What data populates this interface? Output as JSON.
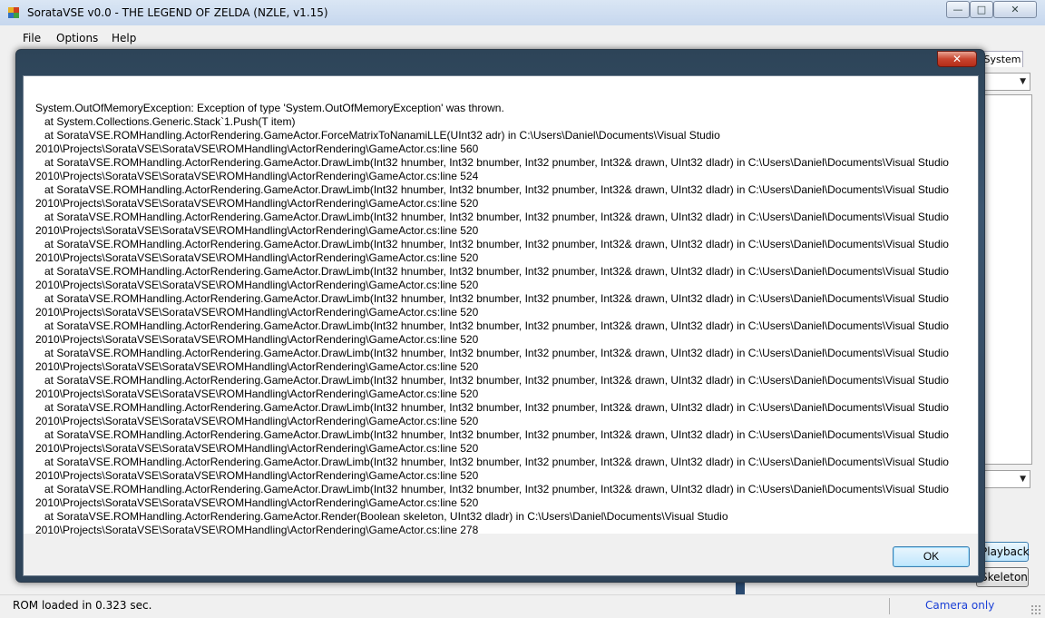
{
  "window": {
    "title": "SorataVSE v0.0 - THE LEGEND OF ZELDA (NZLE, v1.15)",
    "minimize_glyph": "—",
    "maximize_glyph": "□",
    "close_glyph": "✕"
  },
  "menu": {
    "items": [
      "File",
      "Options",
      "Help"
    ]
  },
  "background": {
    "tab_partial": "System",
    "button_playback_partial": "Playback",
    "button_skeleton_partial": "Skeleton"
  },
  "status": {
    "left": "ROM loaded in 0.323 sec.",
    "right": "Camera only"
  },
  "dialog": {
    "close_glyph": "✕",
    "ok_label": "OK",
    "message": "System.OutOfMemoryException: Exception of type 'System.OutOfMemoryException' was thrown.\n   at System.Collections.Generic.Stack`1.Push(T item)\n   at SorataVSE.ROMHandling.ActorRendering.GameActor.ForceMatrixToNanamiLLE(UInt32 adr) in C:\\Users\\Daniel\\Documents\\Visual Studio\n2010\\Projects\\SorataVSE\\SorataVSE\\ROMHandling\\ActorRendering\\GameActor.cs:line 560\n   at SorataVSE.ROMHandling.ActorRendering.GameActor.DrawLimb(Int32 hnumber, Int32 bnumber, Int32 pnumber, Int32& drawn, UInt32 dladr) in C:\\Users\\Daniel\\Documents\\Visual Studio\n2010\\Projects\\SorataVSE\\SorataVSE\\ROMHandling\\ActorRendering\\GameActor.cs:line 524\n   at SorataVSE.ROMHandling.ActorRendering.GameActor.DrawLimb(Int32 hnumber, Int32 bnumber, Int32 pnumber, Int32& drawn, UInt32 dladr) in C:\\Users\\Daniel\\Documents\\Visual Studio\n2010\\Projects\\SorataVSE\\SorataVSE\\ROMHandling\\ActorRendering\\GameActor.cs:line 520\n   at SorataVSE.ROMHandling.ActorRendering.GameActor.DrawLimb(Int32 hnumber, Int32 bnumber, Int32 pnumber, Int32& drawn, UInt32 dladr) in C:\\Users\\Daniel\\Documents\\Visual Studio\n2010\\Projects\\SorataVSE\\SorataVSE\\ROMHandling\\ActorRendering\\GameActor.cs:line 520\n   at SorataVSE.ROMHandling.ActorRendering.GameActor.DrawLimb(Int32 hnumber, Int32 bnumber, Int32 pnumber, Int32& drawn, UInt32 dladr) in C:\\Users\\Daniel\\Documents\\Visual Studio\n2010\\Projects\\SorataVSE\\SorataVSE\\ROMHandling\\ActorRendering\\GameActor.cs:line 520\n   at SorataVSE.ROMHandling.ActorRendering.GameActor.DrawLimb(Int32 hnumber, Int32 bnumber, Int32 pnumber, Int32& drawn, UInt32 dladr) in C:\\Users\\Daniel\\Documents\\Visual Studio\n2010\\Projects\\SorataVSE\\SorataVSE\\ROMHandling\\ActorRendering\\GameActor.cs:line 520\n   at SorataVSE.ROMHandling.ActorRendering.GameActor.DrawLimb(Int32 hnumber, Int32 bnumber, Int32 pnumber, Int32& drawn, UInt32 dladr) in C:\\Users\\Daniel\\Documents\\Visual Studio\n2010\\Projects\\SorataVSE\\SorataVSE\\ROMHandling\\ActorRendering\\GameActor.cs:line 520\n   at SorataVSE.ROMHandling.ActorRendering.GameActor.DrawLimb(Int32 hnumber, Int32 bnumber, Int32 pnumber, Int32& drawn, UInt32 dladr) in C:\\Users\\Daniel\\Documents\\Visual Studio\n2010\\Projects\\SorataVSE\\SorataVSE\\ROMHandling\\ActorRendering\\GameActor.cs:line 520\n   at SorataVSE.ROMHandling.ActorRendering.GameActor.DrawLimb(Int32 hnumber, Int32 bnumber, Int32 pnumber, Int32& drawn, UInt32 dladr) in C:\\Users\\Daniel\\Documents\\Visual Studio\n2010\\Projects\\SorataVSE\\SorataVSE\\ROMHandling\\ActorRendering\\GameActor.cs:line 520\n   at SorataVSE.ROMHandling.ActorRendering.GameActor.DrawLimb(Int32 hnumber, Int32 bnumber, Int32 pnumber, Int32& drawn, UInt32 dladr) in C:\\Users\\Daniel\\Documents\\Visual Studio\n2010\\Projects\\SorataVSE\\SorataVSE\\ROMHandling\\ActorRendering\\GameActor.cs:line 520\n   at SorataVSE.ROMHandling.ActorRendering.GameActor.DrawLimb(Int32 hnumber, Int32 bnumber, Int32 pnumber, Int32& drawn, UInt32 dladr) in C:\\Users\\Daniel\\Documents\\Visual Studio\n2010\\Projects\\SorataVSE\\SorataVSE\\ROMHandling\\ActorRendering\\GameActor.cs:line 520\n   at SorataVSE.ROMHandling.ActorRendering.GameActor.DrawLimb(Int32 hnumber, Int32 bnumber, Int32 pnumber, Int32& drawn, UInt32 dladr) in C:\\Users\\Daniel\\Documents\\Visual Studio\n2010\\Projects\\SorataVSE\\SorataVSE\\ROMHandling\\ActorRendering\\GameActor.cs:line 520\n   at SorataVSE.ROMHandling.ActorRendering.GameActor.DrawLimb(Int32 hnumber, Int32 bnumber, Int32 pnumber, Int32& drawn, UInt32 dladr) in C:\\Users\\Daniel\\Documents\\Visual Studio\n2010\\Projects\\SorataVSE\\SorataVSE\\ROMHandling\\ActorRendering\\GameActor.cs:line 520\n   at SorataVSE.ROMHandling.ActorRendering.GameActor.DrawLimb(Int32 hnumber, Int32 bnumber, Int32 pnumber, Int32& drawn, UInt32 dladr) in C:\\Users\\Daniel\\Documents\\Visual Studio\n2010\\Projects\\SorataVSE\\SorataVSE\\ROMHandling\\ActorRendering\\GameActor.cs:line 520\n   at SorataVSE.ROMHandling.ActorRendering.GameActor.Render(Boolean skeleton, UInt32 dladr) in C:\\Users\\Daniel\\Documents\\Visual Studio\n2010\\Projects\\SorataVSE\\SorataVSE\\ROMHandling\\ActorRendering\\GameActor.cs:line 278"
  },
  "colors": {
    "status_right_text": "#1a3fd6",
    "dialog_close": "#c8452f",
    "ok_button_border": "#3c7fb1"
  }
}
